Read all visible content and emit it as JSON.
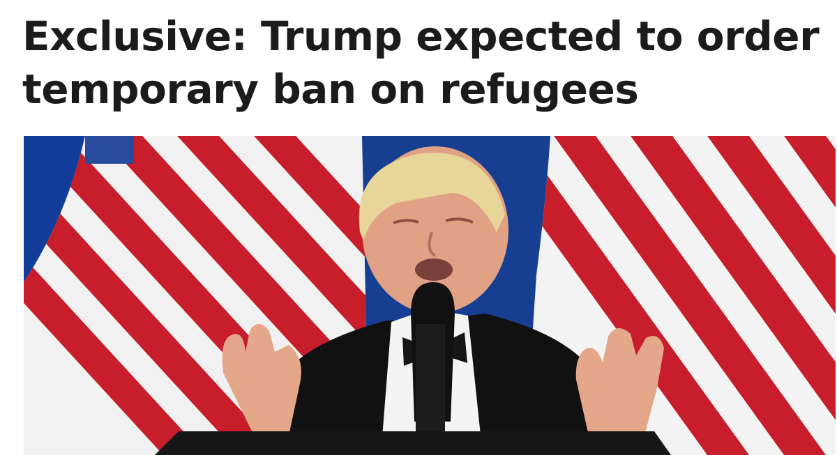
{
  "article": {
    "headline": "Exclusive: Trump expected to order temporary ban on refugees",
    "image": {
      "subject": "speaker-at-podium-with-flags"
    }
  },
  "colors": {
    "headline_text": "#1b1b1b",
    "background_blue": "#123c9a",
    "flag_red": "#c81d2a",
    "flag_white": "#f1f1f1",
    "tuxedo": "#111111",
    "skin": "#e0a184",
    "hair": "#e7d59a"
  }
}
